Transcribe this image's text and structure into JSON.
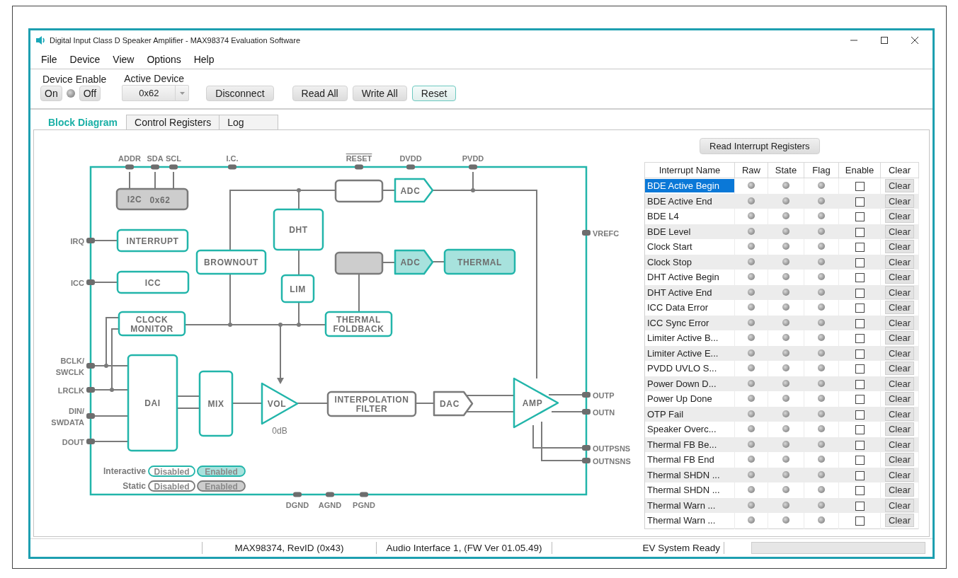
{
  "window": {
    "title": "Digital Input Class D Speaker Amplifier - MAX98374 Evaluation Software"
  },
  "menu": [
    "File",
    "Device",
    "View",
    "Options",
    "Help"
  ],
  "toolbar": {
    "device_enable": {
      "label": "Device Enable",
      "on_button": "On",
      "off_button": "Off",
      "on": false
    },
    "active_device": {
      "label": "Active Device",
      "value": "0x62"
    },
    "buttons": [
      {
        "label": "Disconnect",
        "highlighted": false
      },
      {
        "label": "Read All",
        "highlighted": false
      },
      {
        "label": "Write All",
        "highlighted": false
      },
      {
        "label": "Reset",
        "highlighted": true
      }
    ]
  },
  "tabs": [
    {
      "label": "Block Diagram",
      "selected": true
    },
    {
      "label": "Control Registers",
      "selected": false
    },
    {
      "label": "Log",
      "selected": false
    }
  ],
  "diagram": {
    "pins_top": [
      {
        "label": "ADDR",
        "active_low": false
      },
      {
        "label": "SDA",
        "active_low": false
      },
      {
        "label": "SCL",
        "active_low": false
      },
      {
        "label": "I.C.",
        "active_low": false
      },
      {
        "label": "RESET",
        "active_low": true
      },
      {
        "label": "DVDD",
        "active_low": false
      },
      {
        "label": "PVDD",
        "active_low": false
      }
    ],
    "pins_left": [
      {
        "lines": [
          "IRQ"
        ]
      },
      {
        "lines": [
          "ICC"
        ]
      },
      {
        "lines": [
          "BCLK/",
          "SWCLK"
        ]
      },
      {
        "lines": [
          "LRCLK"
        ]
      },
      {
        "lines": [
          "DIN/",
          "SWDATA"
        ]
      },
      {
        "lines": [
          "DOUT"
        ]
      }
    ],
    "pins_right": [
      {
        "lines": [
          "VREFC"
        ]
      },
      {
        "lines": [
          "OUTP"
        ]
      },
      {
        "lines": [
          "OUTN"
        ]
      },
      {
        "lines": [
          "OUTPSNS"
        ]
      },
      {
        "lines": [
          "OUTNSNS"
        ]
      }
    ],
    "pins_bottom": [
      {
        "lines": [
          "DGND"
        ]
      },
      {
        "lines": [
          "AGND"
        ]
      },
      {
        "lines": [
          "PGND"
        ]
      }
    ],
    "blocks": [
      {
        "lines": [
          "I2C"
        ],
        "value": "0x62",
        "kind": "static",
        "enabled": true
      },
      {
        "lines": [
          "INTERRUPT"
        ],
        "kind": "interactive",
        "enabled": false
      },
      {
        "lines": [
          "ICC"
        ],
        "kind": "interactive",
        "enabled": false
      },
      {
        "lines": [
          "CLOCK",
          "MONITOR"
        ],
        "kind": "interactive",
        "enabled": false
      },
      {
        "lines": [
          "BROWNOUT"
        ],
        "kind": "interactive",
        "enabled": false
      },
      {
        "lines": [
          "DHT"
        ],
        "kind": "interactive",
        "enabled": false
      },
      {
        "lines": [
          "LIM"
        ],
        "kind": "interactive",
        "enabled": false
      },
      {
        "lines": [
          "THERMAL",
          "FOLDBACK"
        ],
        "kind": "interactive",
        "enabled": false
      },
      {
        "kind": "static",
        "enabled": false
      },
      {
        "lines": [
          "ADC"
        ],
        "kind": "interactive",
        "enabled": false
      },
      {
        "kind": "static",
        "enabled": true
      },
      {
        "lines": [
          "ADC"
        ],
        "kind": "interactive",
        "enabled": true
      },
      {
        "lines": [
          "THERMAL"
        ],
        "kind": "interactive",
        "enabled": true
      },
      {
        "lines": [
          "DAI"
        ],
        "kind": "interactive",
        "enabled": false
      },
      {
        "lines": [
          "MIX"
        ],
        "kind": "interactive",
        "enabled": false
      },
      {
        "lines": [
          "VOL"
        ],
        "reading": "0dB",
        "kind": "interactive",
        "enabled": false
      },
      {
        "lines": [
          "INTERPOLATION",
          "FILTER"
        ],
        "kind": "static",
        "enabled": false
      },
      {
        "lines": [
          "DAC"
        ],
        "kind": "static",
        "enabled": false
      },
      {
        "lines": [
          "AMP"
        ],
        "kind": "interactive",
        "enabled": false
      }
    ],
    "legend": [
      {
        "label": "Interactive",
        "kind": "interactive",
        "items": [
          {
            "text": "Disabled",
            "enabled": false
          },
          {
            "text": "Enabled",
            "enabled": true
          }
        ]
      },
      {
        "label": "Static",
        "kind": "static",
        "items": [
          {
            "text": "Disabled",
            "enabled": false
          },
          {
            "text": "Enabled",
            "enabled": true
          }
        ]
      }
    ]
  },
  "interrupts": {
    "read_button": "Read Interrupt Registers",
    "columns": [
      "Interrupt Name",
      "Raw",
      "State",
      "Flag",
      "Enable",
      "Clear"
    ],
    "rows": [
      {
        "name": "BDE Active Begin",
        "selected": true,
        "enabled": false,
        "clear": "Clear"
      },
      {
        "name": "BDE Active End",
        "selected": false,
        "enabled": false,
        "clear": "Clear"
      },
      {
        "name": "BDE L4",
        "selected": false,
        "enabled": false,
        "clear": "Clear"
      },
      {
        "name": "BDE Level",
        "selected": false,
        "enabled": false,
        "clear": "Clear"
      },
      {
        "name": "Clock Start",
        "selected": false,
        "enabled": false,
        "clear": "Clear"
      },
      {
        "name": "Clock Stop",
        "selected": false,
        "enabled": false,
        "clear": "Clear"
      },
      {
        "name": "DHT Active Begin",
        "selected": false,
        "enabled": false,
        "clear": "Clear"
      },
      {
        "name": "DHT Active End",
        "selected": false,
        "enabled": false,
        "clear": "Clear"
      },
      {
        "name": "ICC Data Error",
        "selected": false,
        "enabled": false,
        "clear": "Clear"
      },
      {
        "name": "ICC Sync Error",
        "selected": false,
        "enabled": false,
        "clear": "Clear"
      },
      {
        "name": "Limiter Active B...",
        "selected": false,
        "enabled": false,
        "clear": "Clear"
      },
      {
        "name": "Limiter Active E...",
        "selected": false,
        "enabled": false,
        "clear": "Clear"
      },
      {
        "name": "PVDD UVLO S...",
        "selected": false,
        "enabled": false,
        "clear": "Clear"
      },
      {
        "name": "Power Down D...",
        "selected": false,
        "enabled": false,
        "clear": "Clear"
      },
      {
        "name": "Power Up Done",
        "selected": false,
        "enabled": false,
        "clear": "Clear"
      },
      {
        "name": "OTP Fail",
        "selected": false,
        "enabled": false,
        "clear": "Clear"
      },
      {
        "name": "Speaker Overc...",
        "selected": false,
        "enabled": false,
        "clear": "Clear"
      },
      {
        "name": "Thermal FB Be...",
        "selected": false,
        "enabled": false,
        "clear": "Clear"
      },
      {
        "name": "Thermal FB End",
        "selected": false,
        "enabled": false,
        "clear": "Clear"
      },
      {
        "name": "Thermal SHDN ...",
        "selected": false,
        "enabled": false,
        "clear": "Clear"
      },
      {
        "name": "Thermal SHDN ...",
        "selected": false,
        "enabled": false,
        "clear": "Clear"
      },
      {
        "name": "Thermal Warn ...",
        "selected": false,
        "enabled": false,
        "clear": "Clear"
      },
      {
        "name": "Thermal Warn ...",
        "selected": false,
        "enabled": false,
        "clear": "Clear"
      }
    ]
  },
  "status_bar": {
    "fields": [
      "MAX98374, RevID (0x43)",
      "Audio Interface 1, (FW Ver 01.05.49)",
      "EV System Ready"
    ],
    "progress": {
      "level": 0
    }
  }
}
